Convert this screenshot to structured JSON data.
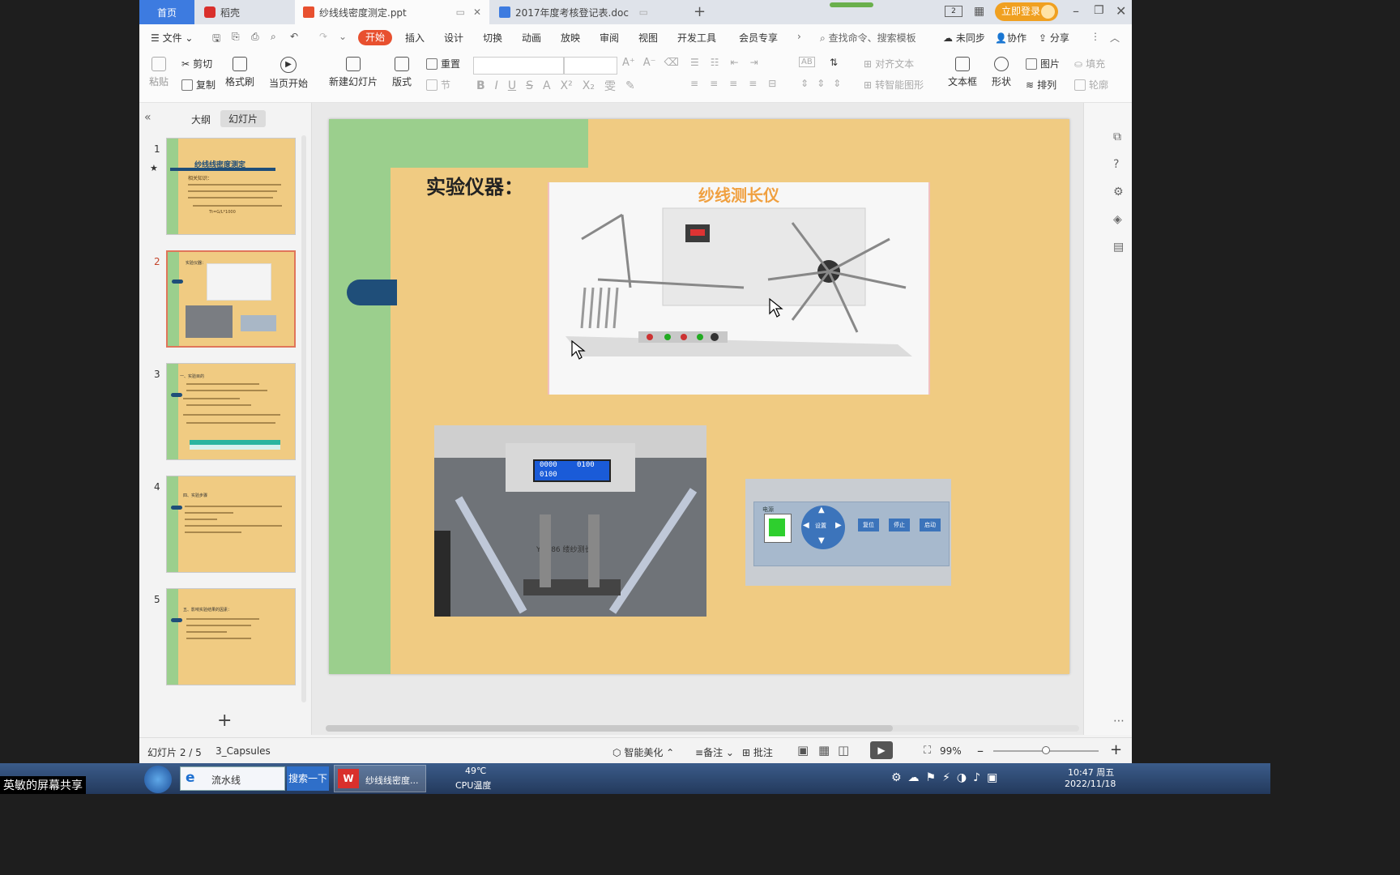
{
  "titlebar": {
    "tabs": [
      {
        "label": "首页"
      },
      {
        "label": "稻壳"
      },
      {
        "label": "纱线线密度测定.ppt"
      },
      {
        "label": "2017年度考核登记表.doc"
      }
    ],
    "login_button": "立即登录"
  },
  "menubar": {
    "file": "文件",
    "items": [
      "开始",
      "插入",
      "设计",
      "切换",
      "动画",
      "放映",
      "审阅",
      "视图",
      "开发工具",
      "会员专享"
    ],
    "active": "开始",
    "search_placeholder": "查找命令、搜索模板",
    "sync": "未同步",
    "collab": "协作",
    "share": "分享"
  },
  "ribbon": {
    "paste": "粘贴",
    "cut": "剪切",
    "copy": "复制",
    "format_painter": "格式刷",
    "start_from_current": "当页开始",
    "new_slide": "新建幻灯片",
    "layout": "版式",
    "reset": "重置",
    "section": "节",
    "align_text": "对齐文本",
    "smart_graphic": "转智能图形",
    "textbox": "文本框",
    "shape": "形状",
    "picture": "图片",
    "fill": "填充",
    "arrange": "排列",
    "outline": "轮廓",
    "ab_label": "AB"
  },
  "sidepanel": {
    "tabs": [
      "大纲",
      "幻灯片"
    ],
    "slide_numbers": [
      "1",
      "2",
      "3",
      "4",
      "5"
    ],
    "thumb1_title": "纱线线密度测定",
    "thumb1_subtitle": "相关知识：",
    "thumb1_formula": "Tt=G/L*1000",
    "thumb2_title": "实验仪器：",
    "thumb3_text": "一、实验目的",
    "thumb4_text": "四、实验步骤",
    "thumb5_text": "五、影响实验结果的因素："
  },
  "slide": {
    "title": "实验仪器：",
    "image1_caption": "纱线测长仪",
    "image2_label": "YG086 缕纱测长机",
    "display_numbers": [
      "0000",
      "0100",
      "0100"
    ],
    "panel_labels": {
      "power": "电源",
      "set": "设置",
      "reset": "复位",
      "stop": "停止",
      "start": "启动"
    }
  },
  "statusbar": {
    "slide_info": "幻灯片 2 / 5",
    "theme": "3_Capsules",
    "smart_beautify": "智能美化",
    "notes": "备注",
    "comment": "批注",
    "zoom": "99%"
  },
  "taskbar": {
    "ie_text": "流水线",
    "search_button": "搜索一下",
    "ppt_item": "纱线线密度...",
    "temp": "49℃",
    "temp_label": "CPU温度",
    "time": "10:47 周五",
    "date": "2022/11/18",
    "share_label": "英敏的屏幕共享"
  },
  "colors": {
    "slide_bg": "#f0cb82",
    "slide_green": "#9bcf8d",
    "slide_navy": "#1f4e79",
    "accent_red": "#e8502f",
    "home_tab": "#3d7be0",
    "login_orange": "#f0a020"
  }
}
